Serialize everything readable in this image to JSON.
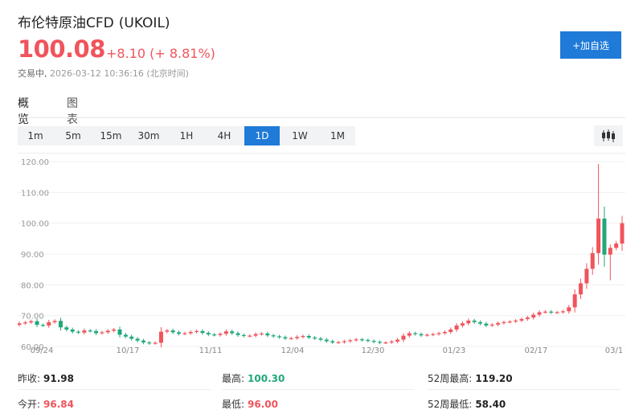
{
  "header": {
    "name": "布伦特原油CFD",
    "code": "(UKOIL)",
    "price": "100.08",
    "change": "+8.10 (+ 8.81%)",
    "status": "交易中",
    "timestamp": "2026-03-12 10:36:16 (北京时间)",
    "add_button": "+加自选"
  },
  "tabs": [
    {
      "label": "概览",
      "active": true
    },
    {
      "label": "图表",
      "active": false
    }
  ],
  "ranges": [
    {
      "label": "1m"
    },
    {
      "label": "5m"
    },
    {
      "label": "15m"
    },
    {
      "label": "30m"
    },
    {
      "label": "1H"
    },
    {
      "label": "4H"
    },
    {
      "label": "1D",
      "active": true
    },
    {
      "label": "1W"
    },
    {
      "label": "1M"
    }
  ],
  "colors": {
    "up": "#f0545c",
    "down": "#20a77a",
    "accent": "#1f7ad8"
  },
  "chart_data": {
    "type": "candlestick",
    "ylim": [
      60,
      120
    ],
    "yticks": [
      "120.00",
      "110.00",
      "100.00",
      "90.00",
      "80.00",
      "70.00",
      "60.00"
    ],
    "xticks": [
      "09/24",
      "10/17",
      "11/11",
      "12/04",
      "12/30",
      "01/23",
      "02/17",
      "03/1"
    ],
    "grid": true,
    "series": [
      {
        "values": [
          67.5,
          67.8,
          68.2,
          67.0,
          66.8,
          67.9,
          68.3,
          66.2,
          65.5,
          64.8,
          64.5,
          65.2,
          65.0,
          64.3,
          64.6,
          65.1,
          65.5,
          63.8,
          63.2,
          62.5,
          61.9,
          61.3,
          61.0,
          61.2,
          64.8,
          65.2,
          64.6,
          64.1,
          64.3,
          64.7,
          65.0,
          64.4,
          63.9,
          63.7,
          64.1,
          64.9,
          64.3,
          63.7,
          63.4,
          63.5,
          64.0,
          64.2,
          63.6,
          63.3,
          63.0,
          62.6,
          62.7,
          63.1,
          63.4,
          62.9,
          62.6,
          62.2,
          61.7,
          61.3,
          61.4,
          61.7,
          62.0,
          62.3,
          62.1,
          61.8,
          61.5,
          61.2,
          61.3,
          61.6,
          62.2,
          63.5,
          64.3,
          64.0,
          63.6,
          63.8,
          64.0,
          64.3,
          64.7,
          65.5,
          66.8,
          67.5,
          68.4,
          67.9,
          67.4,
          66.8,
          67.1,
          67.6,
          67.9,
          68.1,
          68.4,
          68.9,
          69.4,
          70.3,
          71.1,
          71.3,
          71.0,
          71.1,
          71.4,
          72.7,
          76.9,
          80.5,
          85.2,
          90.3,
          101.5,
          89.8,
          92.0,
          93.4,
          100.0
        ]
      }
    ]
  },
  "stats": [
    {
      "label": "昨收:",
      "value": "91.98",
      "color": "dark"
    },
    {
      "label": "最高:",
      "value": "100.30",
      "color": "green"
    },
    {
      "label": "52周最高:",
      "value": "119.20",
      "color": "dark"
    },
    {
      "label": "今开:",
      "value": "96.84",
      "color": "red"
    },
    {
      "label": "最低:",
      "value": "96.00",
      "color": "red"
    },
    {
      "label": "52周最低:",
      "value": "58.40",
      "color": "dark"
    }
  ]
}
